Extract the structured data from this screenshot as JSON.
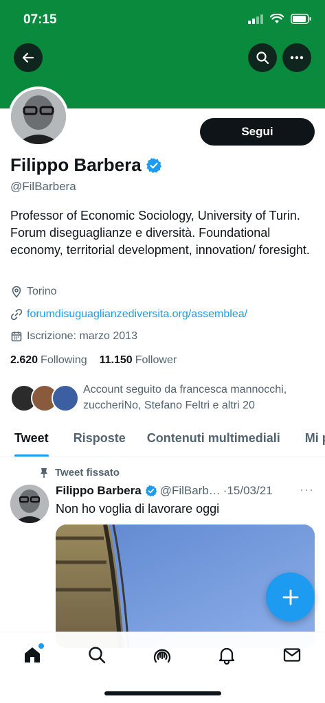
{
  "status_bar": {
    "time": "07:15"
  },
  "colors": {
    "banner": "#0a8a3c",
    "accent": "#1d9bf0",
    "text": "#0f1419",
    "muted": "#536471"
  },
  "profile": {
    "name": "Filippo Barbera",
    "handle": "@FilBarbera",
    "follow_label": "Segui",
    "bio": "Professor of Economic Sociology, University of Turin. Forum diseguaglianze e diversità. Foundational economy, territorial development, innovation/ foresight.",
    "location": "Torino",
    "website": "forumdisuguaglianzediversita.org/assemblea/",
    "joined": "Iscrizione: marzo 2013",
    "following_count": "2.620",
    "following_label": "Following",
    "followers_count": "11.150",
    "followers_label": "Follower",
    "known_followers": "Account seguito da francesca mannocchi, zuccheriNo, Stefano Feltri e altri 20"
  },
  "tabs": [
    {
      "label": "Tweet",
      "active": true
    },
    {
      "label": "Risposte"
    },
    {
      "label": "Contenuti multimediali"
    },
    {
      "label": "Mi piace"
    }
  ],
  "pinned_tweet": {
    "pinned_label": "Tweet fissato",
    "author_name": "Filippo Barbera",
    "author_handle": "@FilBarb…",
    "date": "·15/03/21",
    "text": "Non ho voglia di lavorare oggi"
  },
  "icons": [
    "back-arrow-icon",
    "search-icon",
    "more-icon",
    "verified-badge-icon",
    "location-pin-icon",
    "link-icon",
    "calendar-icon",
    "pin-icon",
    "compose-plus-icon",
    "home-icon",
    "explore-search-icon",
    "spaces-icon",
    "notifications-bell-icon",
    "messages-mail-icon"
  ]
}
